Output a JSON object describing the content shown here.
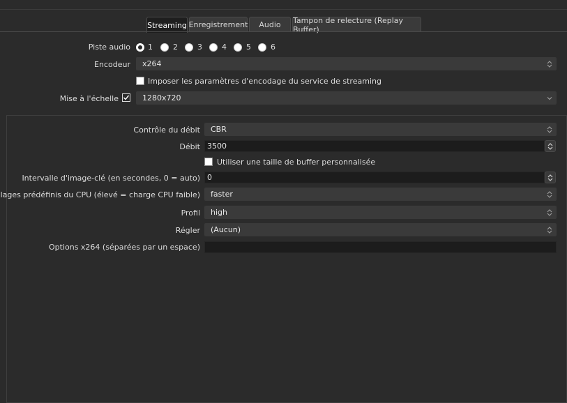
{
  "tabs": [
    {
      "label": "Streaming",
      "active": true
    },
    {
      "label": "Enregistrement",
      "active": false
    },
    {
      "label": "Audio",
      "active": false
    },
    {
      "label": "Tampon de relecture (Replay Buffer)",
      "active": false
    }
  ],
  "audio_track": {
    "label": "Piste audio",
    "options": [
      "1",
      "2",
      "3",
      "4",
      "5",
      "6"
    ],
    "selected": "1"
  },
  "encoder": {
    "label": "Encodeur",
    "value": "x264"
  },
  "enforce_service": {
    "label": "Imposer les paramètres d'encodage du service de streaming",
    "checked": false
  },
  "rescale": {
    "label": "Mise à l'échelle",
    "checked": true,
    "value": "1280x720"
  },
  "rate_control": {
    "label": "Contrôle du débit",
    "value": "CBR"
  },
  "bitrate": {
    "label": "Débit",
    "value": "3500"
  },
  "custom_buffer": {
    "label": "Utiliser une taille de buffer personnalisée",
    "checked": false
  },
  "keyframe_interval": {
    "label": "Intervalle d'image-clé (en secondes, 0 = auto)",
    "value": "0"
  },
  "cpu_preset": {
    "label": "Réglages prédéfinis du CPU (élevé = charge CPU faible)",
    "value": "faster"
  },
  "profile": {
    "label": "Profil",
    "value": "high"
  },
  "tune": {
    "label": "Régler",
    "value": "(Aucun)"
  },
  "x264_options": {
    "label": "Options x264 (séparées par un espace)",
    "value": ""
  },
  "icons": {
    "combo_arrows": "updown-chevron-icon",
    "dropdown_arrow": "chevron-down-icon",
    "check": "checkmark-icon"
  }
}
